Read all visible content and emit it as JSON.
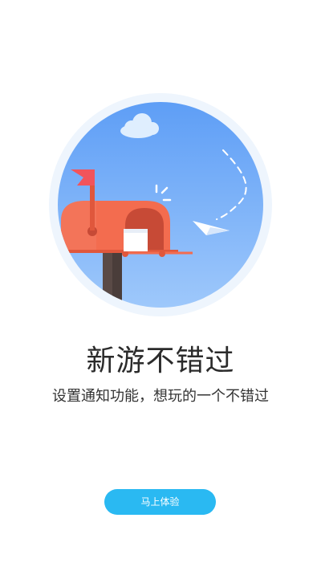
{
  "onboarding": {
    "headline": "新游不错过",
    "subtitle": "设置通知功能，想玩的一个不错过",
    "cta_label": "马上体验"
  },
  "colors": {
    "accent": "#2ab9f2",
    "circle_outer": "#eef5fd",
    "circle_inner": "#6fa9f8",
    "mailbox": "#f36c4f",
    "flag": "#f2545b",
    "post": "#5a4a46"
  },
  "icons": [
    "cloud-icon",
    "mailbox-icon",
    "flag-icon",
    "letter-icon",
    "paper-plane-icon"
  ]
}
